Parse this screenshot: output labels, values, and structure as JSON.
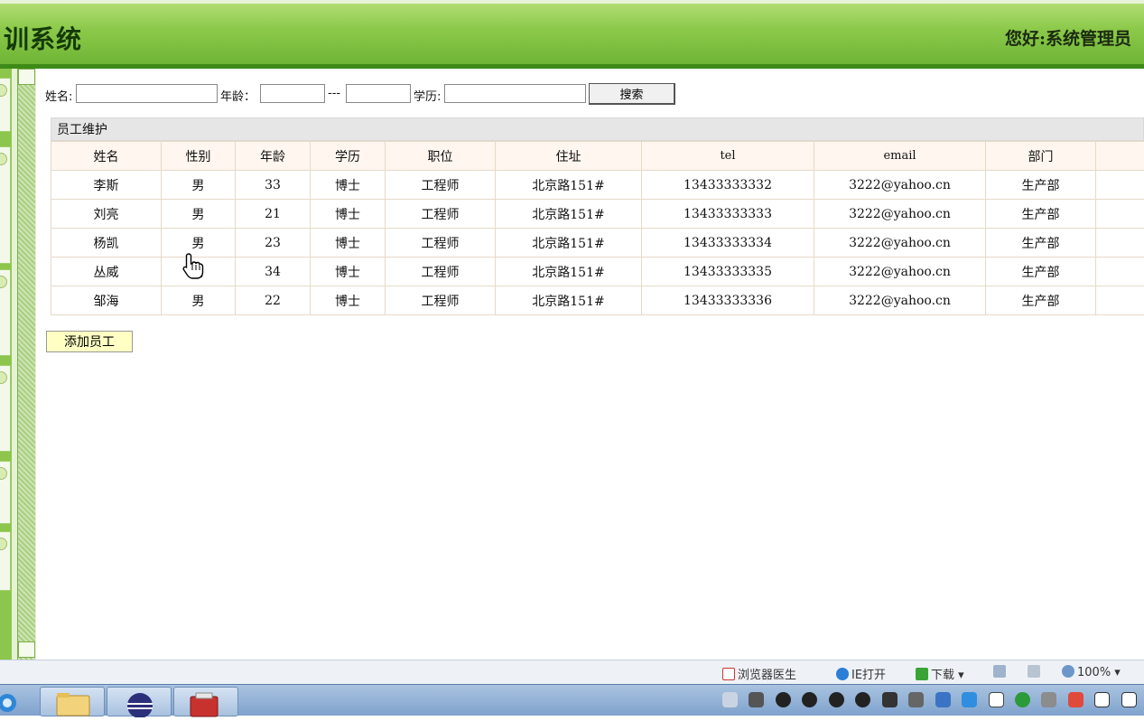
{
  "header": {
    "title": "训系统",
    "greeting": "您好:系统管理员"
  },
  "search": {
    "name_label": "姓名:",
    "age_label": "年龄：",
    "range_sep": "---",
    "edu_label": "学历:",
    "name_value": "",
    "age_from": "",
    "age_to": "",
    "edu_value": "",
    "button": "搜索"
  },
  "table": {
    "section_title": "员工维护",
    "columns": [
      "姓名",
      "性别",
      "年龄",
      "学历",
      "职位",
      "住址",
      "tel",
      "email",
      "部门",
      ""
    ],
    "rows": [
      [
        "李斯",
        "男",
        "33",
        "博士",
        "工程师",
        "北京路151#",
        "13433333332",
        "3222@yahoo.cn",
        "生产部",
        ""
      ],
      [
        "刘亮",
        "男",
        "21",
        "博士",
        "工程师",
        "北京路151#",
        "13433333333",
        "3222@yahoo.cn",
        "生产部",
        ""
      ],
      [
        "杨凯",
        "男",
        "23",
        "博士",
        "工程师",
        "北京路151#",
        "13433333334",
        "3222@yahoo.cn",
        "生产部",
        ""
      ],
      [
        "丛威",
        "男",
        "34",
        "博士",
        "工程师",
        "北京路151#",
        "13433333335",
        "3222@yahoo.cn",
        "生产部",
        ""
      ],
      [
        "邹海",
        "男",
        "22",
        "博士",
        "工程师",
        "北京路151#",
        "13433333336",
        "3222@yahoo.cn",
        "生产部",
        ""
      ]
    ]
  },
  "add_button": "添加员工",
  "statusbar": {
    "doctor": "浏览器医生",
    "ie_open": "IE打开",
    "download": "下载",
    "zoom": "100%"
  },
  "colors": {
    "header_green": "#8cc94a",
    "header_border": "#3e8a17",
    "add_button_bg": "#ffffc4",
    "table_header_bg": "#fff6ef"
  }
}
